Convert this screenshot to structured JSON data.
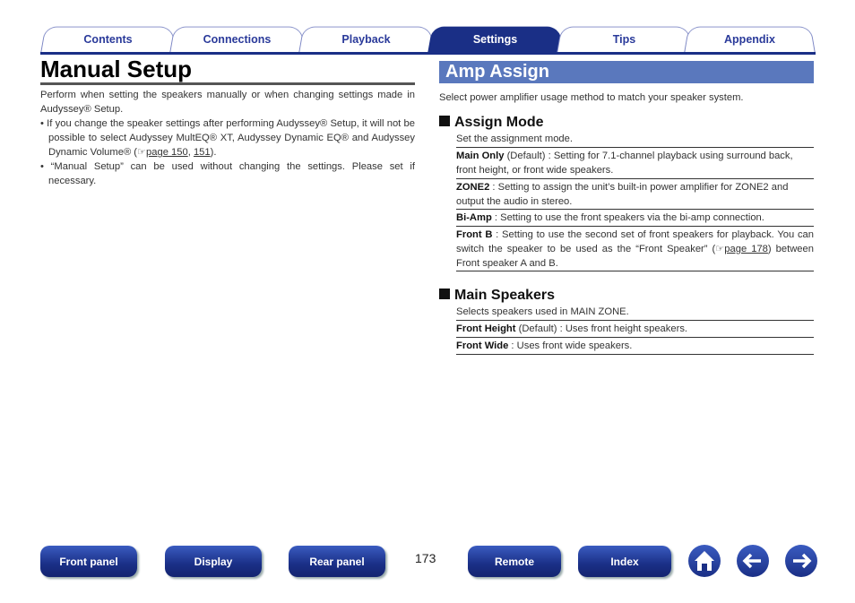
{
  "tabs": [
    {
      "label": "Contents"
    },
    {
      "label": "Connections"
    },
    {
      "label": "Playback"
    },
    {
      "label": "Settings",
      "active": true
    },
    {
      "label": "Tips"
    },
    {
      "label": "Appendix"
    }
  ],
  "left": {
    "title": "Manual Setup",
    "intro": "Perform when setting the speakers manually or when changing settings made in Audyssey® Setup.",
    "bullets": [
      {
        "text": "• If you change the speaker settings after performing Audyssey® Setup, it will not be possible to select Audyssey MultEQ® XT, Audyssey Dynamic EQ® and Audyssey Dynamic Volume® (",
        "link1": "page 150",
        "sep": ", ",
        "link2": "151",
        "end": ")."
      },
      {
        "text": "• “Manual Setup” can be used without changing the settings. Please set if necessary."
      }
    ]
  },
  "right": {
    "title": "Amp Assign",
    "intro": "Select power amplifier usage method to match your speaker system.",
    "assign": {
      "heading": "Assign Mode",
      "desc": "Set the assignment mode.",
      "rows": [
        {
          "term": "Main Only",
          "note": " (Default) : ",
          "text": "Setting for 7.1-channel playback using surround back, front height, or front wide speakers."
        },
        {
          "term": "ZONE2",
          "note": " : ",
          "text": "Setting to assign the unit’s built-in power amplifier for ZONE2 and output the audio in stereo."
        },
        {
          "term": "Bi-Amp",
          "note": " : ",
          "text": "Setting to use the front speakers via the bi-amp connection."
        },
        {
          "term": "Front B",
          "note": " : ",
          "text": "Setting to use the second set of front speakers for playback. You can switch the speaker to be used as the “Front Speaker” (",
          "link": "page 178",
          "text2": ") between Front speaker A and B."
        }
      ]
    },
    "main": {
      "heading": "Main Speakers",
      "desc": "Selects speakers used in MAIN ZONE.",
      "rows": [
        {
          "term": "Front Height",
          "note": " (Default) : ",
          "text": "Uses front height speakers."
        },
        {
          "term": "Front Wide",
          "note": " : ",
          "text": "Uses front wide speakers."
        }
      ]
    }
  },
  "footer": {
    "buttons": [
      "Front panel",
      "Display",
      "Rear panel",
      "Remote",
      "Index"
    ],
    "page": "173",
    "icons": [
      "home-icon",
      "back-arrow-icon",
      "forward-arrow-icon"
    ]
  },
  "colors": {
    "navy": "#1a2f86",
    "section": "#5a78bd"
  }
}
